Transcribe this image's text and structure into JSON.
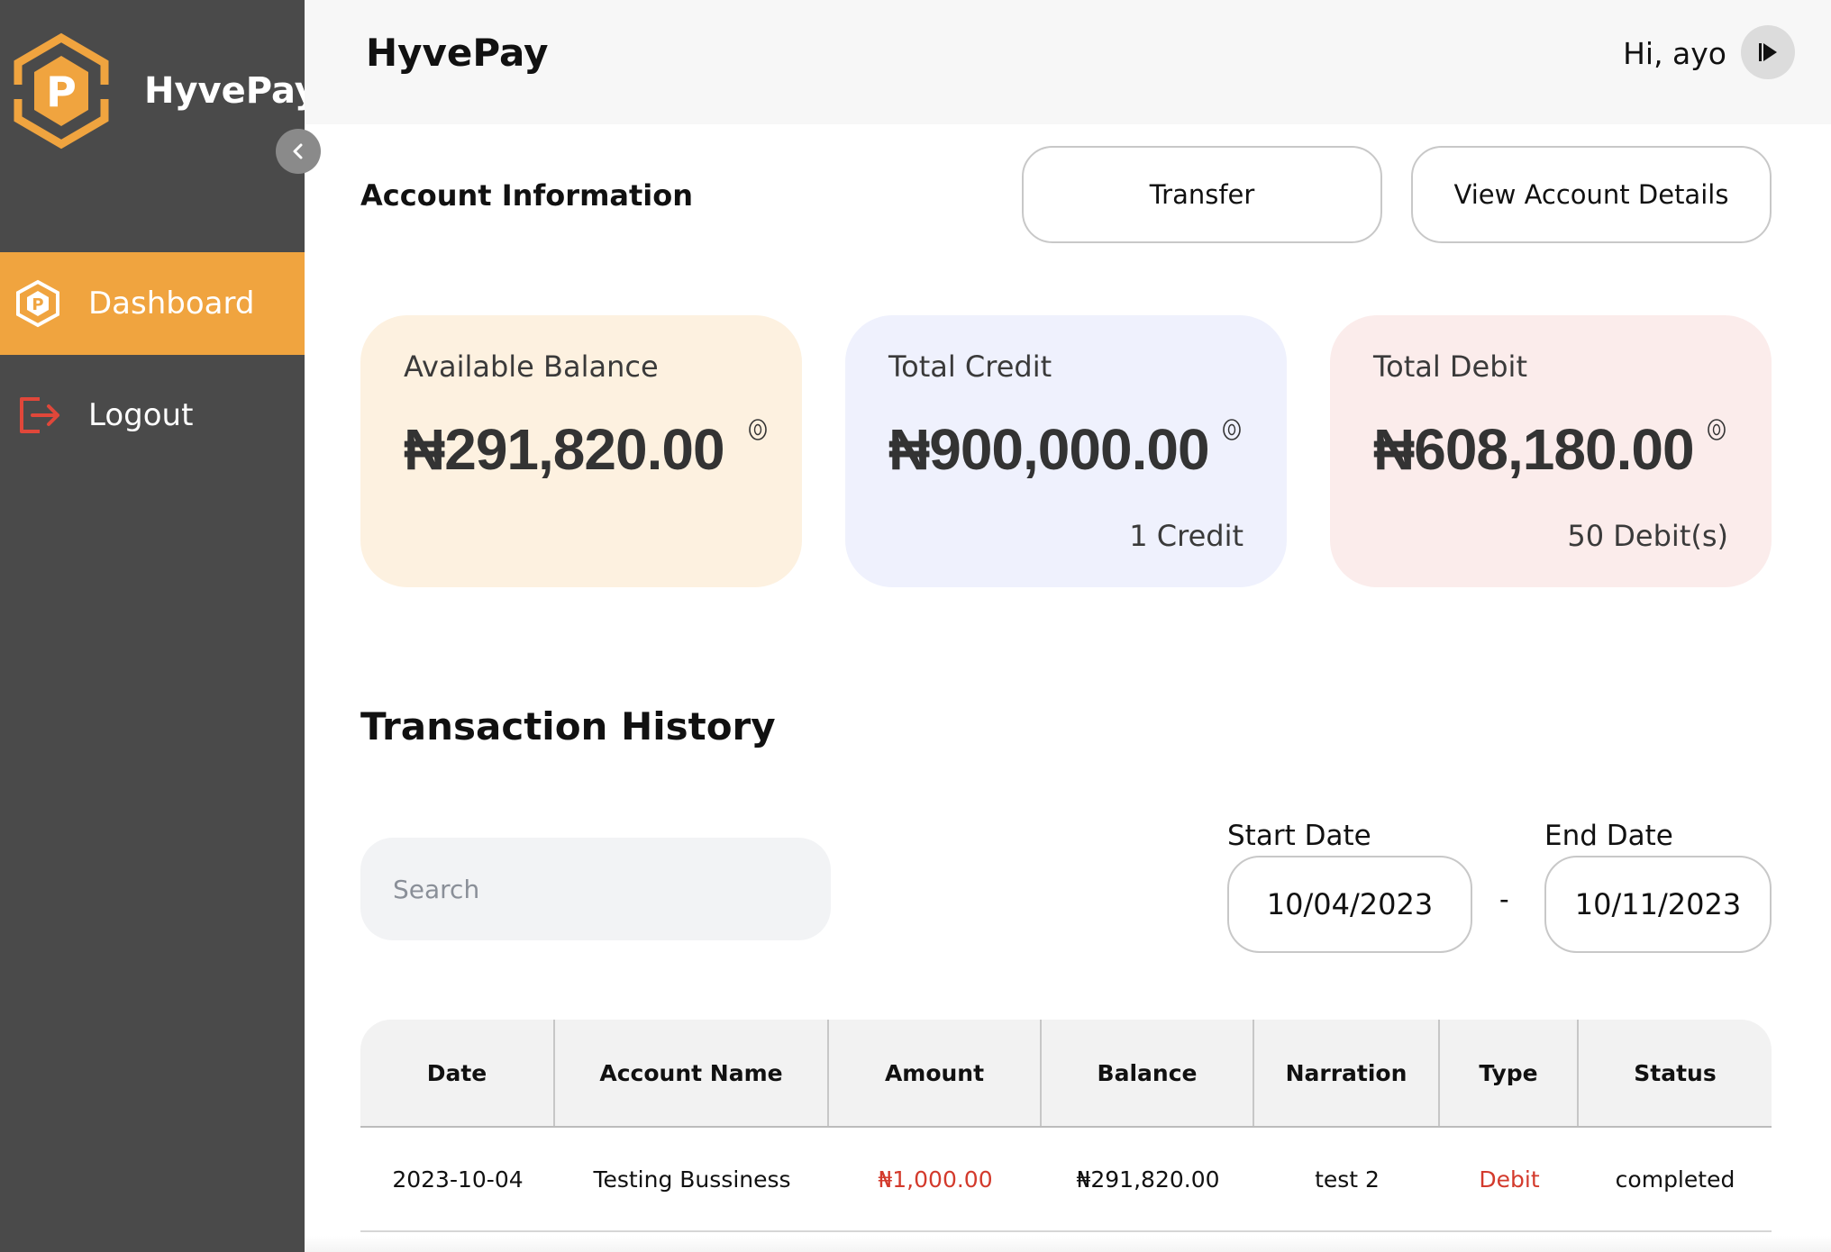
{
  "sidebar": {
    "brand": "HyvePay",
    "items": [
      {
        "label": "Dashboard",
        "icon": "hyvepay-logo-icon",
        "active": true
      },
      {
        "label": "Logout",
        "icon": "logout-icon",
        "active": false
      }
    ]
  },
  "header": {
    "title": "HyvePay",
    "greeting": "Hi, ayo"
  },
  "account": {
    "title": "Account Information",
    "transfer_label": "Transfer",
    "view_details_label": "View Account Details",
    "cards": [
      {
        "label": "Available Balance",
        "amount": "₦291,820.00",
        "count": ""
      },
      {
        "label": "Total Credit",
        "amount": "₦900,000.00",
        "count": "1 Credit"
      },
      {
        "label": "Total Debit",
        "amount": "₦608,180.00",
        "count": "50 Debit(s)"
      }
    ]
  },
  "history": {
    "title": "Transaction History",
    "search_placeholder": "Search",
    "start_date_label": "Start Date",
    "start_date": "10/04/2023",
    "end_date_label": "End Date",
    "end_date": "10/11/2023",
    "separator": "-",
    "columns": [
      "Date",
      "Account Name",
      "Amount",
      "Balance",
      "Narration",
      "Type",
      "Status"
    ],
    "rows": [
      {
        "date": "2023-10-04",
        "account_name": "Testing Bussiness",
        "amount": "₦1,000.00",
        "balance": "₦291,820.00",
        "narration": "test 2",
        "type": "Debit",
        "status": "completed"
      }
    ]
  },
  "colors": {
    "sidebar_bg": "#4a4a4a",
    "accent": "#f0a43f",
    "debit_red": "#d33a2c",
    "card_balance": "#fdf1e0",
    "card_credit": "#eff1fd",
    "card_debit": "#fbeceb"
  }
}
